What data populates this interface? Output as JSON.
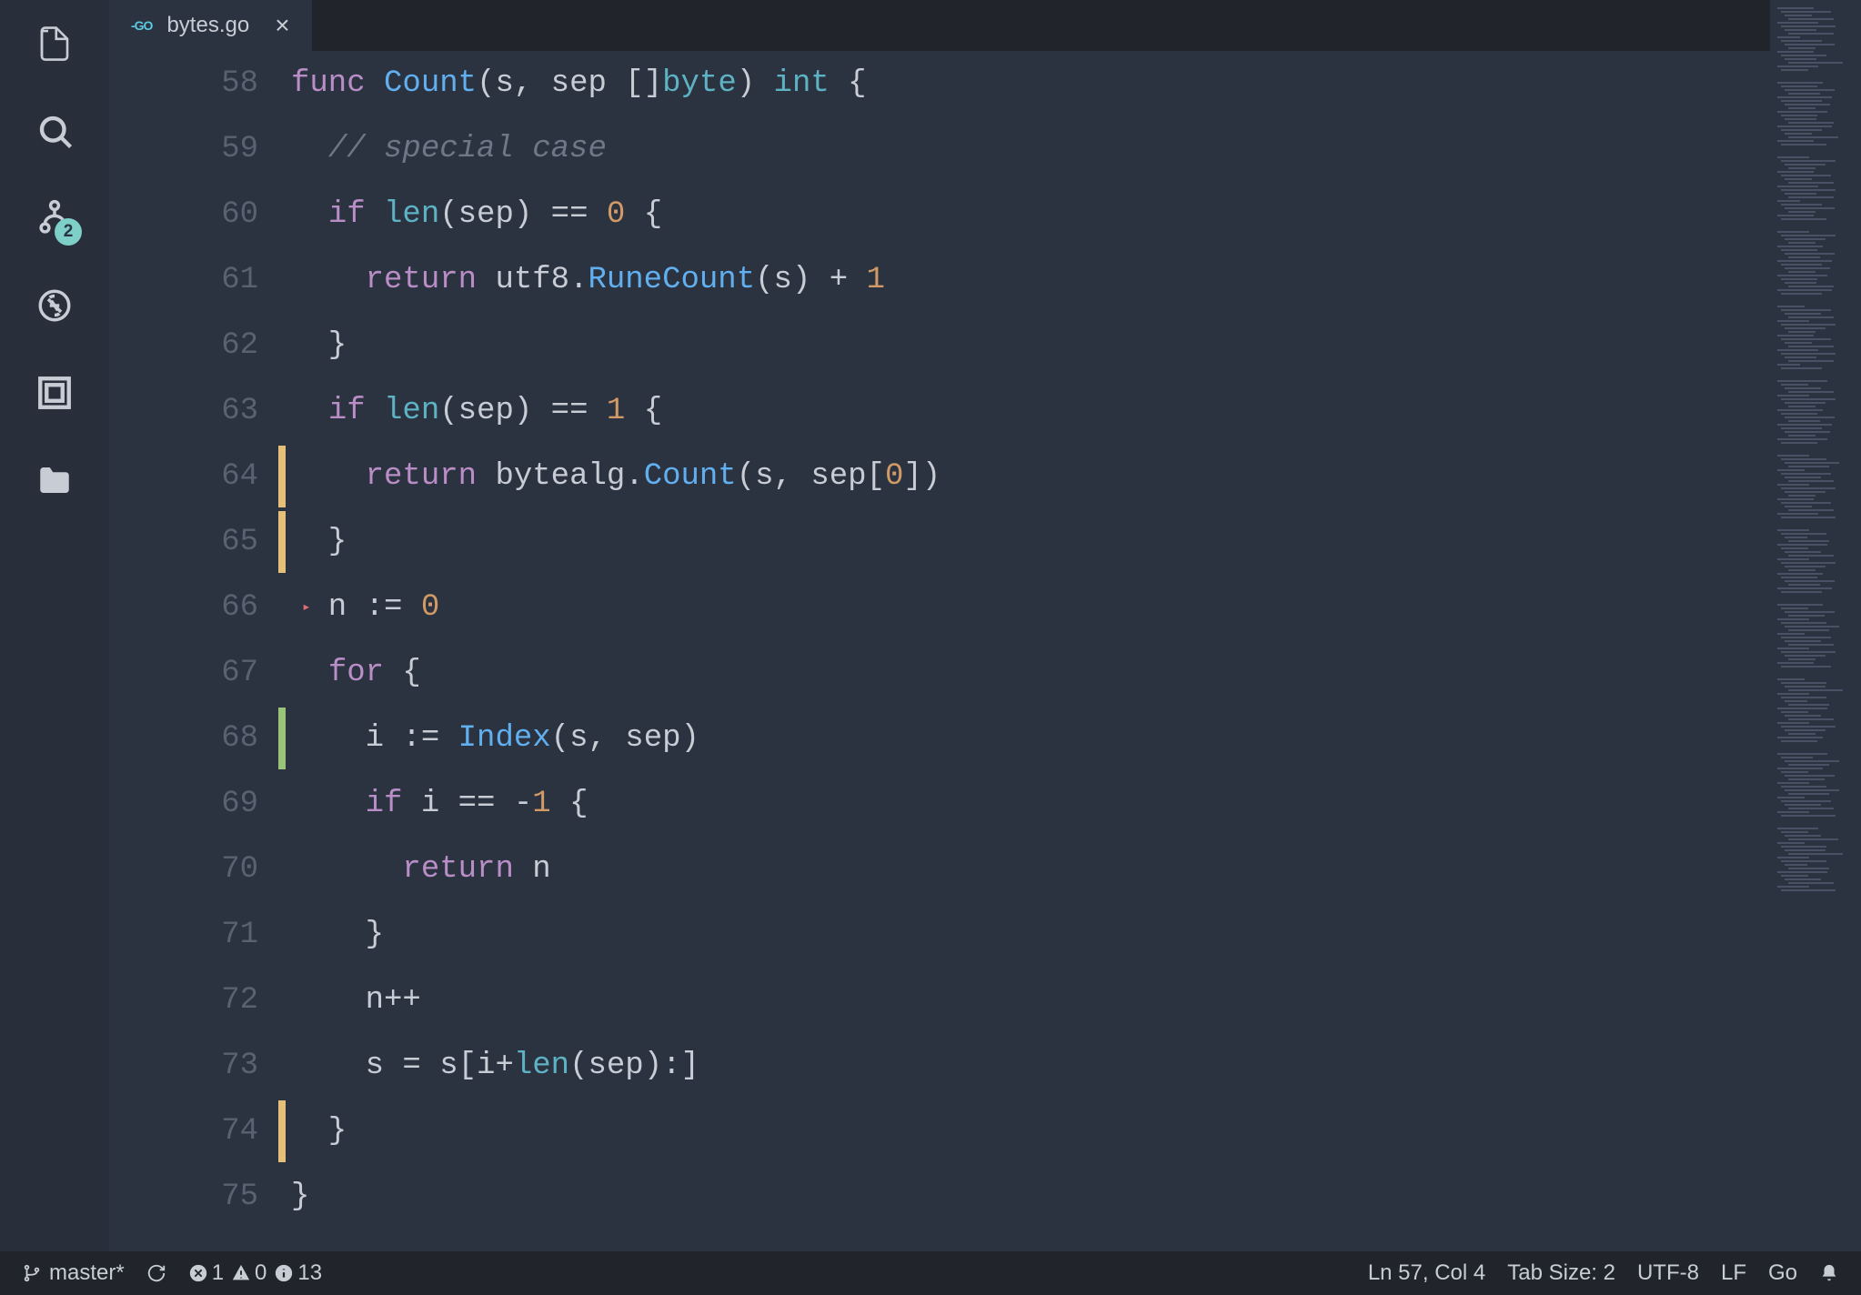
{
  "tab": {
    "icon_label": "-GO",
    "filename": "bytes.go"
  },
  "scm_badge": "2",
  "code_lines": [
    {
      "num": "58",
      "tokens": [
        {
          "t": "func ",
          "c": "kw"
        },
        {
          "t": "Count",
          "c": "fn"
        },
        {
          "t": "(s, sep []",
          "c": "txt"
        },
        {
          "t": "byte",
          "c": "typ"
        },
        {
          "t": ") ",
          "c": "txt"
        },
        {
          "t": "int",
          "c": "typ"
        },
        {
          "t": " {",
          "c": "txt"
        }
      ]
    },
    {
      "num": "59",
      "tokens": [
        {
          "t": "  ",
          "c": "txt"
        },
        {
          "t": "// special case",
          "c": "cmt"
        }
      ]
    },
    {
      "num": "60",
      "tokens": [
        {
          "t": "  ",
          "c": "txt"
        },
        {
          "t": "if",
          "c": "kw"
        },
        {
          "t": " ",
          "c": "txt"
        },
        {
          "t": "len",
          "c": "typ"
        },
        {
          "t": "(sep) ",
          "c": "txt"
        },
        {
          "t": "==",
          "c": "op"
        },
        {
          "t": " ",
          "c": "txt"
        },
        {
          "t": "0",
          "c": "num"
        },
        {
          "t": " {",
          "c": "txt"
        }
      ]
    },
    {
      "num": "61",
      "tokens": [
        {
          "t": "    ",
          "c": "txt"
        },
        {
          "t": "return",
          "c": "kw"
        },
        {
          "t": " utf8.",
          "c": "txt"
        },
        {
          "t": "RuneCount",
          "c": "fn"
        },
        {
          "t": "(s) ",
          "c": "txt"
        },
        {
          "t": "+",
          "c": "op"
        },
        {
          "t": " ",
          "c": "txt"
        },
        {
          "t": "1",
          "c": "num"
        }
      ]
    },
    {
      "num": "62",
      "tokens": [
        {
          "t": "  }",
          "c": "txt"
        }
      ]
    },
    {
      "num": "63",
      "tokens": [
        {
          "t": "  ",
          "c": "txt"
        },
        {
          "t": "if",
          "c": "kw"
        },
        {
          "t": " ",
          "c": "txt"
        },
        {
          "t": "len",
          "c": "typ"
        },
        {
          "t": "(sep) ",
          "c": "txt"
        },
        {
          "t": "==",
          "c": "op"
        },
        {
          "t": " ",
          "c": "txt"
        },
        {
          "t": "1",
          "c": "num"
        },
        {
          "t": " {",
          "c": "txt"
        }
      ]
    },
    {
      "num": "64",
      "git": "y",
      "tokens": [
        {
          "t": "    ",
          "c": "txt"
        },
        {
          "t": "return",
          "c": "kw"
        },
        {
          "t": " bytealg.",
          "c": "txt"
        },
        {
          "t": "Count",
          "c": "fn"
        },
        {
          "t": "(s, sep[",
          "c": "txt"
        },
        {
          "t": "0",
          "c": "num"
        },
        {
          "t": "])",
          "c": "txt"
        }
      ]
    },
    {
      "num": "65",
      "git": "y",
      "tokens": [
        {
          "t": "  }",
          "c": "txt"
        }
      ]
    },
    {
      "num": "66",
      "fold": true,
      "tokens": [
        {
          "t": "  n ",
          "c": "txt"
        },
        {
          "t": ":=",
          "c": "op"
        },
        {
          "t": " ",
          "c": "txt"
        },
        {
          "t": "0",
          "c": "num"
        }
      ]
    },
    {
      "num": "67",
      "tokens": [
        {
          "t": "  ",
          "c": "txt"
        },
        {
          "t": "for",
          "c": "kw"
        },
        {
          "t": " {",
          "c": "txt"
        }
      ]
    },
    {
      "num": "68",
      "git": "g",
      "tokens": [
        {
          "t": "    i ",
          "c": "txt"
        },
        {
          "t": ":=",
          "c": "op"
        },
        {
          "t": " ",
          "c": "txt"
        },
        {
          "t": "Index",
          "c": "fn"
        },
        {
          "t": "(s, sep)",
          "c": "txt"
        }
      ]
    },
    {
      "num": "69",
      "tokens": [
        {
          "t": "    ",
          "c": "txt"
        },
        {
          "t": "if",
          "c": "kw"
        },
        {
          "t": " i ",
          "c": "txt"
        },
        {
          "t": "==",
          "c": "op"
        },
        {
          "t": " ",
          "c": "txt"
        },
        {
          "t": "-",
          "c": "op"
        },
        {
          "t": "1",
          "c": "num"
        },
        {
          "t": " {",
          "c": "txt"
        }
      ]
    },
    {
      "num": "70",
      "tokens": [
        {
          "t": "      ",
          "c": "txt"
        },
        {
          "t": "return",
          "c": "kw"
        },
        {
          "t": " n",
          "c": "txt"
        }
      ]
    },
    {
      "num": "71",
      "tokens": [
        {
          "t": "    }",
          "c": "txt"
        }
      ]
    },
    {
      "num": "72",
      "tokens": [
        {
          "t": "    n",
          "c": "txt"
        },
        {
          "t": "++",
          "c": "op"
        }
      ]
    },
    {
      "num": "73",
      "tokens": [
        {
          "t": "    s ",
          "c": "txt"
        },
        {
          "t": "=",
          "c": "op"
        },
        {
          "t": " s[i",
          "c": "txt"
        },
        {
          "t": "+",
          "c": "op"
        },
        {
          "t": "len",
          "c": "typ"
        },
        {
          "t": "(sep):]",
          "c": "txt"
        }
      ]
    },
    {
      "num": "74",
      "git": "y",
      "tokens": [
        {
          "t": "  }",
          "c": "txt"
        }
      ]
    },
    {
      "num": "75",
      "tokens": [
        {
          "t": "}",
          "c": "txt"
        }
      ]
    }
  ],
  "status": {
    "branch": "master*",
    "errors": "1",
    "warnings": "0",
    "info": "13",
    "position": "Ln 57, Col 4",
    "tab_size": "Tab Size: 2",
    "encoding": "UTF-8",
    "eol": "LF",
    "language": "Go"
  }
}
